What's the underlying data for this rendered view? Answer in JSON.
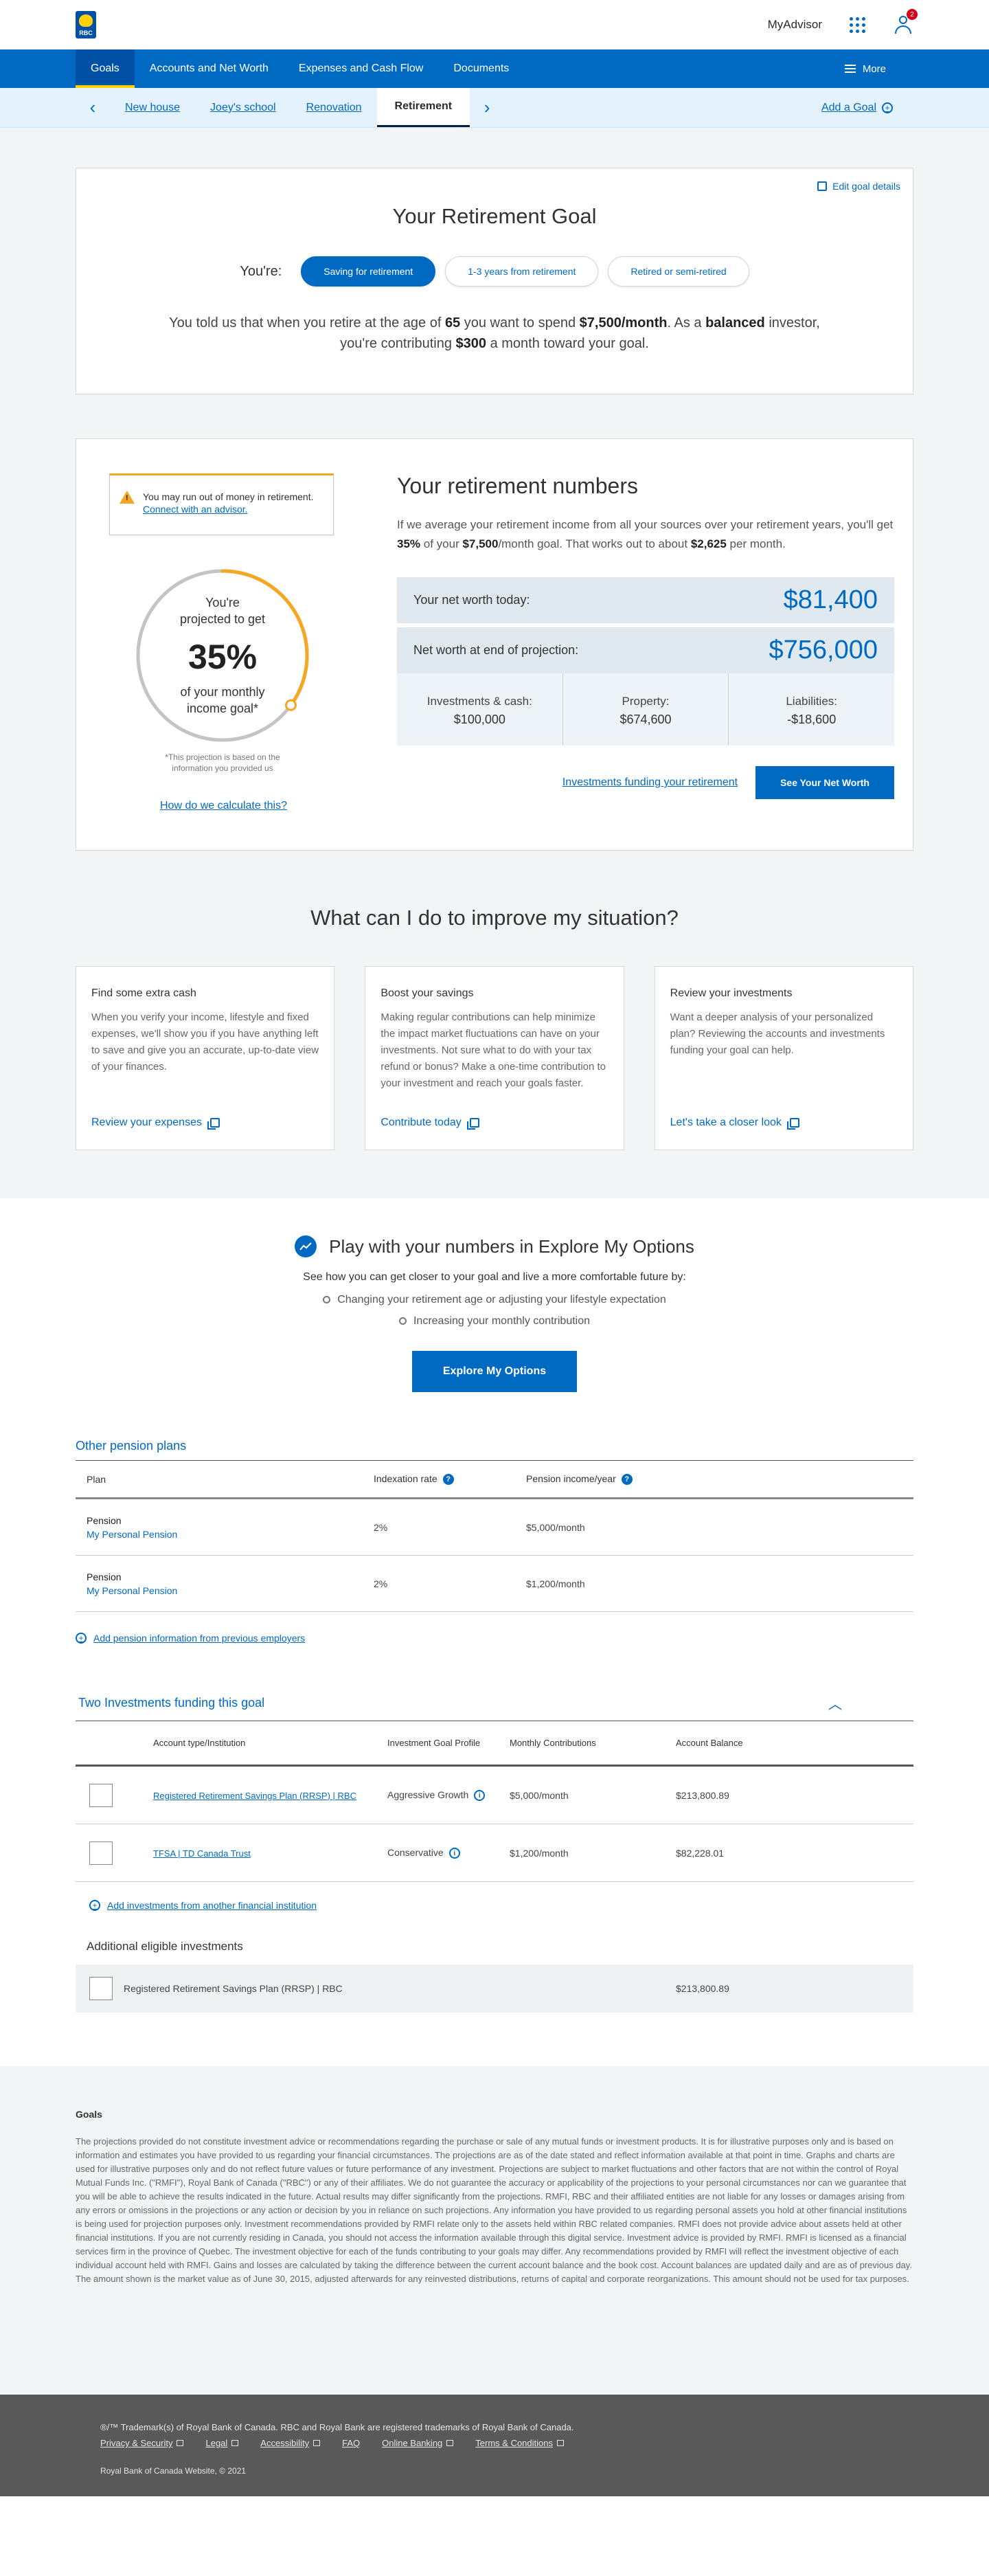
{
  "header": {
    "logo_text": "RBC",
    "myadvisor": "MyAdvisor",
    "notification_count": "2"
  },
  "main_nav": {
    "items": [
      {
        "label": "Goals",
        "active": true
      },
      {
        "label": "Accounts and Net Worth"
      },
      {
        "label": "Expenses and Cash Flow"
      },
      {
        "label": "Documents"
      }
    ],
    "more": "More"
  },
  "sub_nav": {
    "tabs": [
      {
        "label": "New house"
      },
      {
        "label": "Joey's school"
      },
      {
        "label": "Renovation"
      },
      {
        "label": "Retirement",
        "active": true
      }
    ],
    "add_goal": "Add a Goal"
  },
  "goal": {
    "edit": "Edit goal details",
    "title": "Your Retirement Goal",
    "youre": "You're:",
    "options": [
      "Saving for retirement",
      "1-3 years from retirement",
      "Retired or semi-retired"
    ],
    "selected_index": 0,
    "desc_1": "You told us that when you retire at the age of ",
    "age": "65",
    "desc_2": " you want to spend ",
    "spend": "$7,500/month",
    "desc_3": ". As a ",
    "profile": "balanced",
    "desc_4": " investor, you're contributing ",
    "contribution": "$300",
    "desc_5": " a month toward your goal."
  },
  "numbers": {
    "warning": "You may run out of money in retirement.",
    "warning_link": "Connect with an advisor.",
    "gauge_line1": "You're",
    "gauge_line2": "projected to get",
    "percent": "35%",
    "percent_value": 35,
    "gauge_line3": "of your monthly",
    "gauge_line4": "income goal*",
    "note": "*This projection is based on the information you provided us",
    "how_calc": "How do we calculate this?",
    "title": "Your retirement numbers",
    "desc_1": "If we average your retirement income from all your sources over your retirement years, you'll get ",
    "pct": "35%",
    "desc_2": " of your ",
    "goal_amount": "$7,500",
    "desc_3": "/month goal. That works out to about ",
    "monthly": "$2,625",
    "desc_4": " per month.",
    "net_worth_label": "Your net worth today:",
    "net_worth_value": "$81,400",
    "end_label": "Net worth at end of projection:",
    "end_value": "$756,000",
    "breakdown": [
      {
        "label": "Investments & cash:",
        "value": "$100,000"
      },
      {
        "label": "Property:",
        "value": "$674,600"
      },
      {
        "label": "Liabilities:",
        "value": "-$18,600"
      }
    ],
    "inv_link": "Investments funding your retirement",
    "see_btn": "See Your Net Worth"
  },
  "improve": {
    "title": "What can I do to improve my situation?",
    "cards": [
      {
        "title": "Find some extra cash",
        "body": "When you verify your income, lifestyle and fixed expenses, we'll show you if you have anything left to save and give you an accurate, up-to-date view of your finances.",
        "link": "Review your expenses"
      },
      {
        "title": "Boost your savings",
        "body": "Making regular contributions can help minimize the impact market fluctuations can have on your investments. Not sure what to do with your tax refund or bonus? Make a one-time contribution to your investment and reach your goals faster.",
        "link": "Contribute today"
      },
      {
        "title": "Review your investments",
        "body": "Want a deeper analysis of your personalized plan? Reviewing the accounts and investments funding your goal can help.",
        "link": "Let's take a closer look"
      }
    ]
  },
  "explore": {
    "title": "Play with your numbers in Explore My Options",
    "sub": "See how you can get closer to your goal and live a more comfortable future by:",
    "bullets": [
      "Changing your retirement age or adjusting your lifestyle expectation",
      "Increasing your monthly contribution"
    ],
    "button": "Explore My Options"
  },
  "pension": {
    "title": "Other pension plans",
    "headers": [
      "Plan",
      "Indexation rate",
      "Pension income/year"
    ],
    "rows": [
      {
        "plan": "Pension",
        "sub": "My Personal Pension",
        "rate": "2%",
        "income": "$5,000/month"
      },
      {
        "plan": "Pension",
        "sub": "My Personal Pension",
        "rate": "2%",
        "income": "$1,200/month"
      }
    ],
    "add": "Add pension information from previous employers"
  },
  "investments": {
    "title": "Two Investments funding this goal",
    "headers": [
      "Account type/Institution",
      "Investment Goal Profile",
      "Monthly Contributions",
      "Account Balance"
    ],
    "rows": [
      {
        "account": "Registered Retirement Savings Plan (RRSP) | RBC",
        "profile": "Aggressive Growth",
        "monthly": "$5,000/month",
        "balance": "$213,800.89"
      },
      {
        "account": "TFSA | TD Canada Trust",
        "profile": "Conservative",
        "monthly": "$1,200/month",
        "balance": "$82,228.01"
      }
    ],
    "add": "Add investments from another financial institution",
    "additional_title": "Additional eligible investments",
    "additional": {
      "account": "Registered Retirement Savings Plan (RRSP) | RBC",
      "balance": "$213,800.89"
    }
  },
  "disclaimer": {
    "title": "Goals",
    "text": "The projections provided do not constitute investment advice or recommendations regarding the purchase or sale of any mutual funds or investment products. It is for illustrative purposes only and is based on information and estimates you have provided to us regarding your financial circumstances. The projections are as of the date stated and reflect information available at that point in time. Graphs and charts are used for illustrative purposes only and do not reflect future values or future performance of any investment. Projections are subject to market fluctuations and other factors that are not within the control of Royal Mutual Funds Inc. (\"RMFI\"), Royal Bank of Canada (\"RBC\") or any of their affiliates. We do not guarantee the accuracy or applicability of the projections to your personal circumstances nor can we guarantee that you will be able to achieve the results indicated in the future. Actual results may differ significantly from the projections. RMFI, RBC and their affiliated entities are not liable for any losses or damages arising from any errors or omissions in the projections or any action or decision by you in reliance on such projections. Any information you have provided to us regarding personal assets you hold at other financial institutions is being used for projection purposes only. Investment recommendations provided by RMFI relate only to the assets held within RBC related companies. RMFI does not provide advice about assets held at other financial institutions. If you are not currently residing in Canada, you should not access the information available through this digital service. Investment advice is provided by RMFI. RMFI is licensed as a financial services firm in the province of Quebec. The investment objective for each of the funds contributing to your goals may differ. Any recommendations provided by RMFI will reflect the investment objective of each individual account held with RMFI. Gains and losses are calculated by taking the difference between the current account balance and the book cost. Account balances are updated daily and are as of previous day. The amount shown is the market value as of June 30, 2015, adjusted afterwards for any reinvested distributions, returns of capital and corporate reorganizations. This amount should not be used for tax purposes."
  },
  "footer": {
    "trademark": "®/™ Trademark(s) of Royal Bank of Canada. RBC and Royal Bank are registered trademarks of Royal Bank of Canada.",
    "links": [
      "Privacy & Security",
      "Legal",
      "Accessibility",
      "FAQ",
      "Online Banking",
      "Terms & Conditions"
    ],
    "copyright": "Royal Bank of Canada Website, © 2021"
  }
}
